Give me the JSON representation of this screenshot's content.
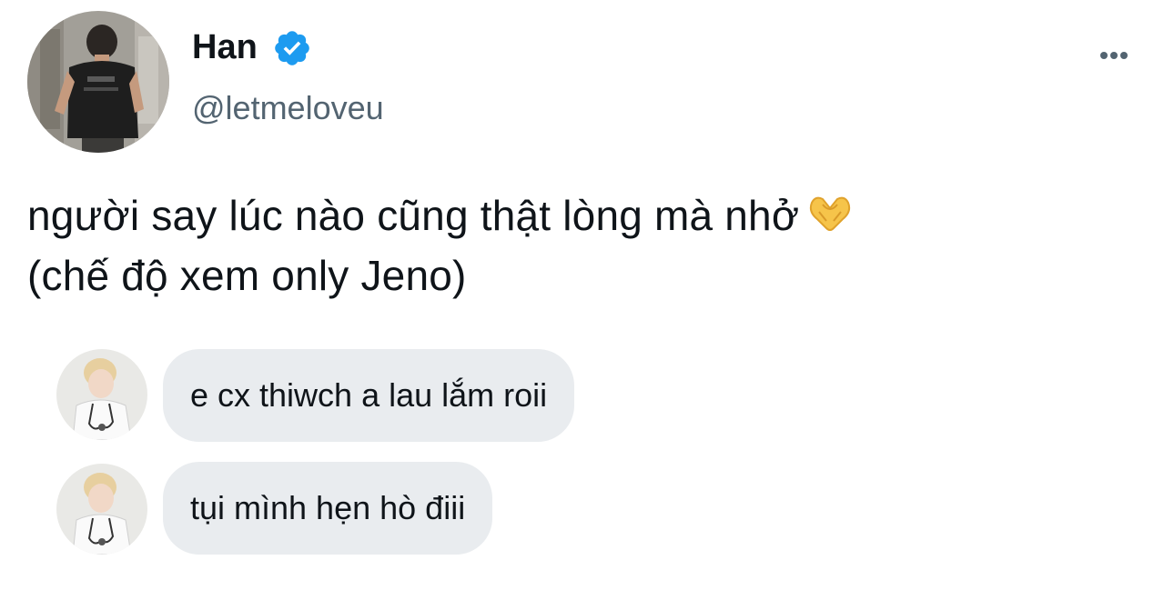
{
  "author": {
    "display_name": "Han",
    "handle": "@letmeloveu",
    "verified_icon": "verified-badge-icon",
    "avatar_icon": "profile-photo-man-in-elevator"
  },
  "more_icon": "more-options-icon",
  "tweet": {
    "line1": "người say lúc nào cũng thật lòng mà nhở",
    "line2": "(chế độ xem only Jeno)",
    "emoji": "heart-hands-icon"
  },
  "messages": [
    {
      "text": "e cx thiwch a lau lắm roii",
      "avatar_icon": "profile-photo-blonde-doctor"
    },
    {
      "text": "tụi mình hẹn hò điii",
      "avatar_icon": "profile-photo-blonde-doctor"
    }
  ],
  "colors": {
    "verified": "#1d9bf0",
    "handle": "#536471",
    "bubble": "#e9ecef",
    "text": "#0f1419"
  }
}
